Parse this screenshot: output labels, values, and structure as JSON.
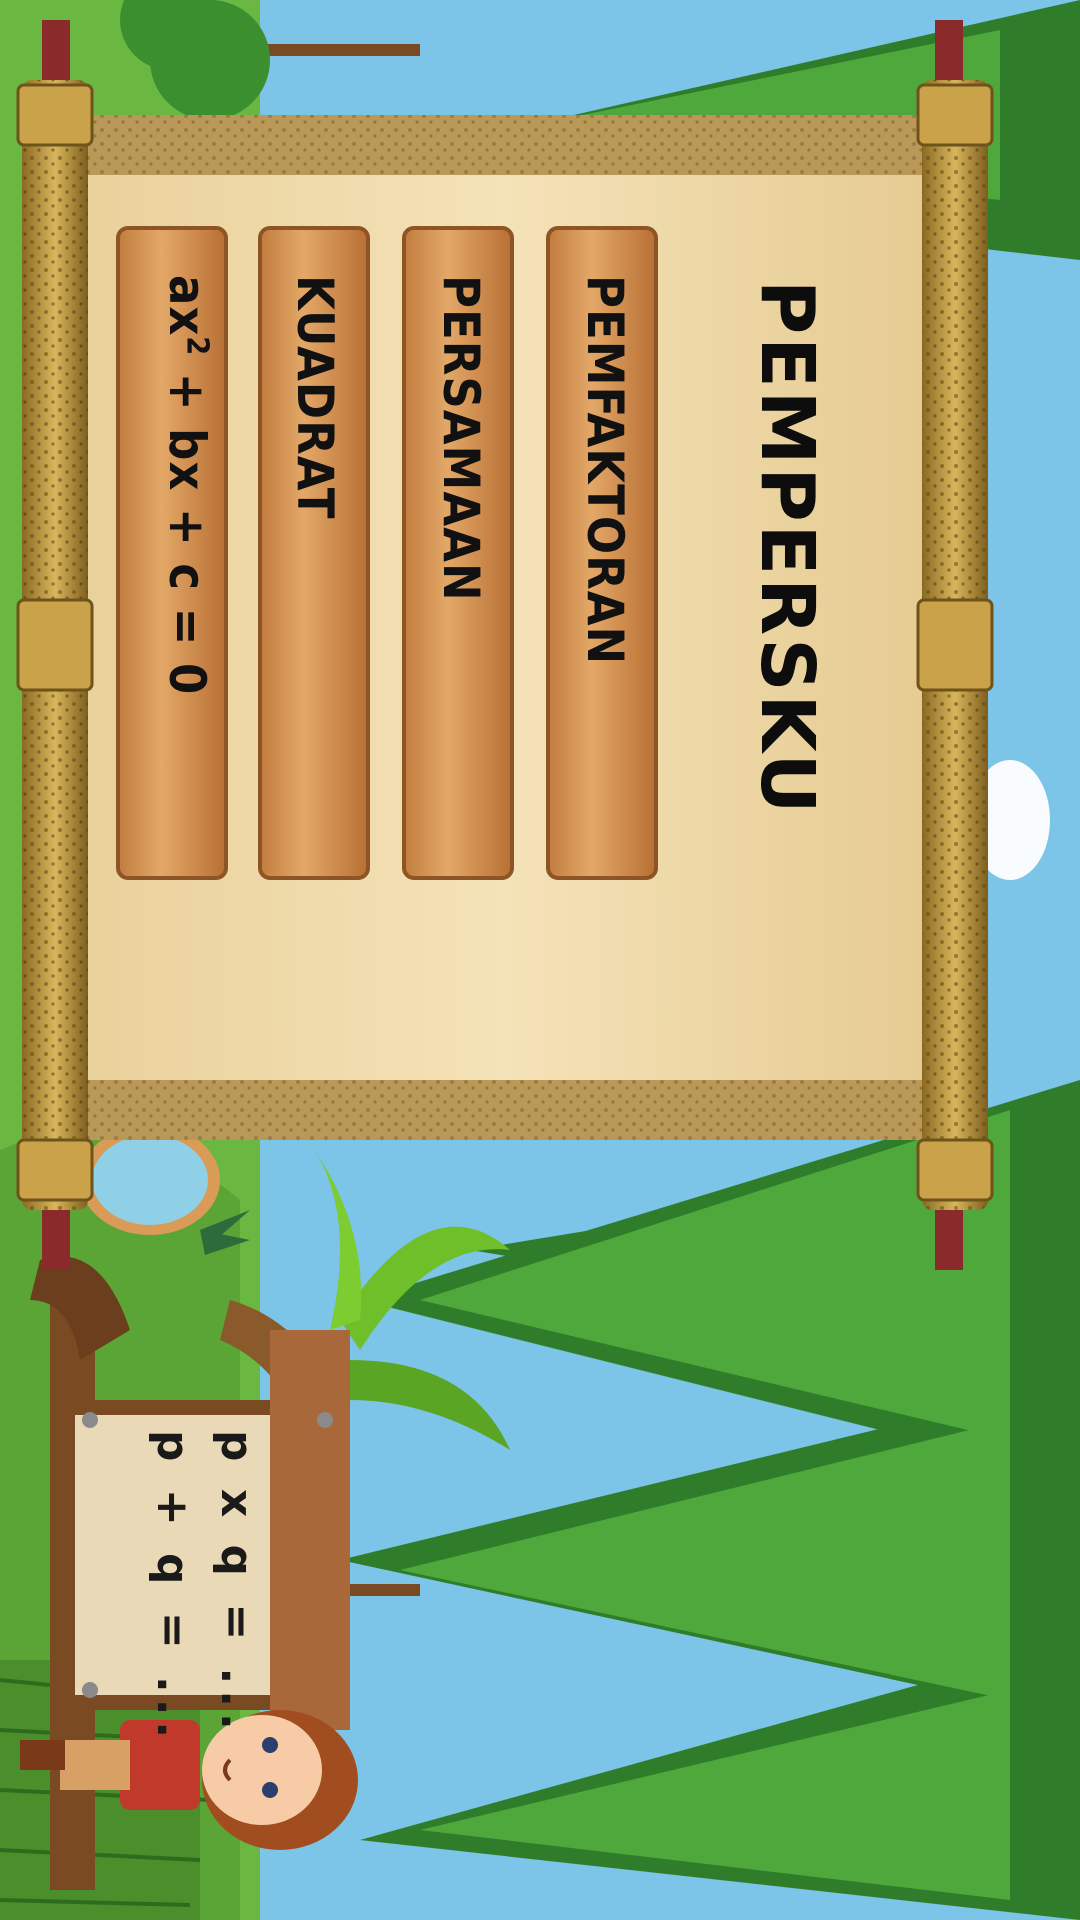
{
  "menu": {
    "title": "PEMPERSKU",
    "buttons": [
      {
        "label": "PEMFAKTORAN"
      },
      {
        "label": "PERSAMAAN"
      },
      {
        "label": "KUADRAT"
      }
    ],
    "formula": {
      "base": "ax",
      "exponent": "2",
      "rest": " + bx + c = 0"
    }
  },
  "sign": {
    "line1": "p x q = ...",
    "line2": "p + q = ..."
  },
  "colors": {
    "sky": "#7cc4e8",
    "tree_dark": "#2f7d2a",
    "tree_light": "#4fa83b",
    "scroll_paper": "#eed9a8",
    "scroll_rod": "#c9a24a",
    "plank": "#d89a5a"
  }
}
